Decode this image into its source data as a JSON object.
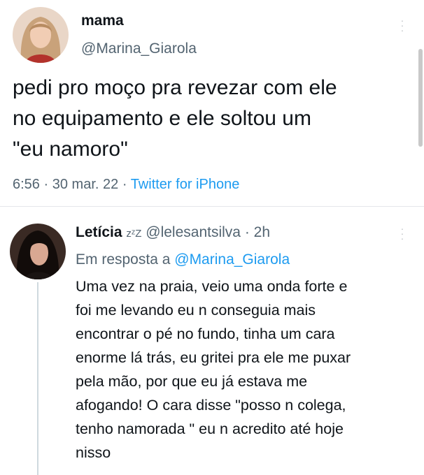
{
  "tweet": {
    "display_name": "mama",
    "handle": "@Marina_Giarola",
    "text": "pedi pro moço pra revezar com ele\nno equipamento e ele soltou um\n\"eu namoro\"",
    "time": "6:56",
    "date": "30 mar. 22",
    "source": "Twitter for iPhone",
    "separator": "·"
  },
  "reply": {
    "display_name": "Letícia",
    "name_emoji": "zᶻZ",
    "handle": "@lelesantsilva",
    "time_ago": "2h",
    "separator": "·",
    "in_reply_prefix": "Em resposta a",
    "in_reply_handle": "@Marina_Giarola",
    "text": "Uma vez na praia, veio uma onda forte e\nfoi me levando eu n conseguia mais\nencontrar o pé no fundo, tinha um cara\nenorme lá trás, eu gritei pra ele me puxar\npela mão, por que eu já estava me\nafogando! O cara disse \"posso n colega,\ntenho namorada \" eu n acredito até hoje\nnisso"
  },
  "icons": {
    "tweet_more": "more-vertical-icon",
    "reply_more": "more-vertical-icon"
  },
  "colors": {
    "link": "#1d9bf0",
    "secondary_text": "#536471",
    "primary_text": "#0f1419"
  }
}
